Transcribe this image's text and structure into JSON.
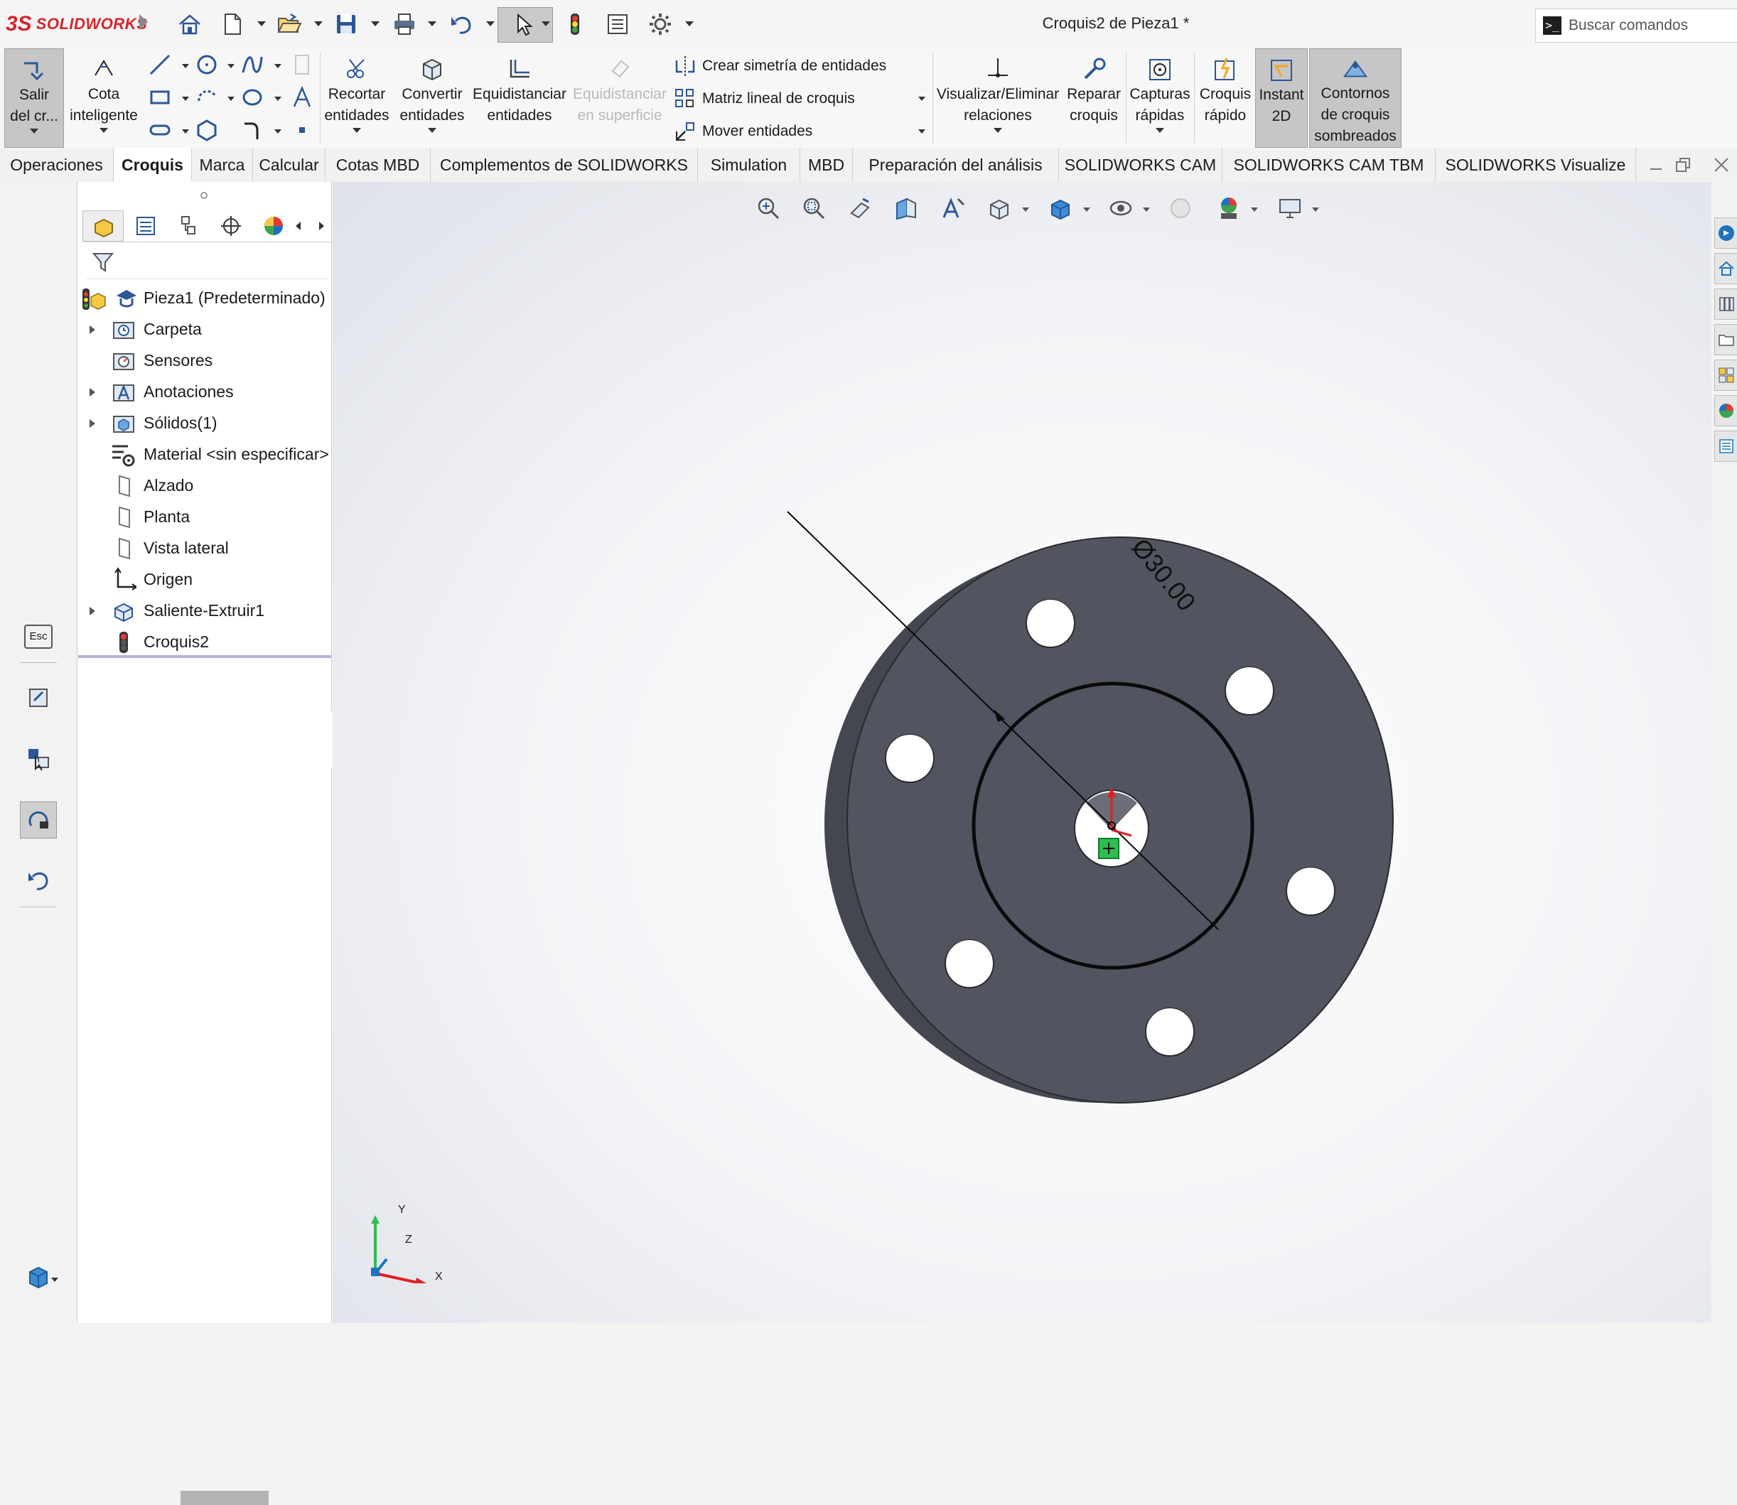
{
  "app": {
    "brand_mark": "3S",
    "brand_name": "SOLIDWORKS"
  },
  "document_title": "Croquis2 de Pieza1 *",
  "search": {
    "placeholder": "Buscar comandos"
  },
  "quick_access": [
    "home-icon",
    "new-document-icon",
    "open-icon",
    "save-icon",
    "print-icon",
    "undo-icon",
    "select-icon",
    "rebuild-icon",
    "file-properties-icon",
    "options-icon"
  ],
  "ribbon": {
    "exit_sketch": [
      "Salir",
      "del cr..."
    ],
    "smart_dimension": [
      "Cota",
      "inteligente"
    ],
    "trim": [
      "Recortar",
      "entidades"
    ],
    "convert": [
      "Convertir",
      "entidades"
    ],
    "offset": [
      "Equidistanciar",
      "entidades"
    ],
    "offset_surface": [
      "Equidistanciar",
      "en superficie"
    ],
    "mirror": "Crear simetría de entidades",
    "linear_pattern": "Matriz lineal de croquis",
    "move": "Mover entidades",
    "relations": [
      "Visualizar/Eliminar",
      "relaciones"
    ],
    "repair": [
      "Reparar",
      "croquis"
    ],
    "quick_snaps": [
      "Capturas",
      "rápidas"
    ],
    "rapid_sketch": [
      "Croquis",
      "rápido"
    ],
    "instant2d": [
      "Instant",
      "2D"
    ],
    "shaded_contours": [
      "Contornos",
      "de croquis",
      "sombreados"
    ]
  },
  "tabs": [
    "Operaciones",
    "Croquis",
    "Marca",
    "Calcular",
    "Cotas MBD",
    "Complementos de SOLIDWORKS",
    "Simulation",
    "MBD",
    "Preparación del análisis",
    "SOLIDWORKS CAM",
    "SOLIDWORKS CAM TBM",
    "SOLIDWORKS Visualize"
  ],
  "active_tab": "Croquis",
  "feature_tree": {
    "root": "Pieza1  (Predeterminado)",
    "items": [
      {
        "label": "Carpeta",
        "expandable": true,
        "icon": "history-folder-icon"
      },
      {
        "label": "Sensores",
        "expandable": false,
        "icon": "sensor-icon"
      },
      {
        "label": "Anotaciones",
        "expandable": true,
        "icon": "annotation-icon"
      },
      {
        "label": "Sólidos(1)",
        "expandable": true,
        "icon": "solid-bodies-icon"
      },
      {
        "label": "Material <sin especificar>",
        "expandable": false,
        "icon": "material-icon"
      },
      {
        "label": "Alzado",
        "expandable": false,
        "icon": "plane-icon"
      },
      {
        "label": "Planta",
        "expandable": false,
        "icon": "plane-icon"
      },
      {
        "label": "Vista lateral",
        "expandable": false,
        "icon": "plane-icon"
      },
      {
        "label": "Origen",
        "expandable": false,
        "icon": "origin-icon"
      },
      {
        "label": "Saliente-Extruir1",
        "expandable": true,
        "icon": "extrude-icon"
      },
      {
        "label": "Croquis2",
        "expandable": false,
        "icon": "sketch-icon"
      }
    ]
  },
  "left_strip": {
    "esc_label": "Esc"
  },
  "viewport": {
    "dimension_label": "Ø30.00",
    "triad": {
      "x": "X",
      "y": "Y",
      "z": "Z"
    }
  },
  "colors": {
    "part_face": "#52555f",
    "part_side": "#444750",
    "brand_red": "#d3262c",
    "accent_blue": "#1e73be"
  }
}
